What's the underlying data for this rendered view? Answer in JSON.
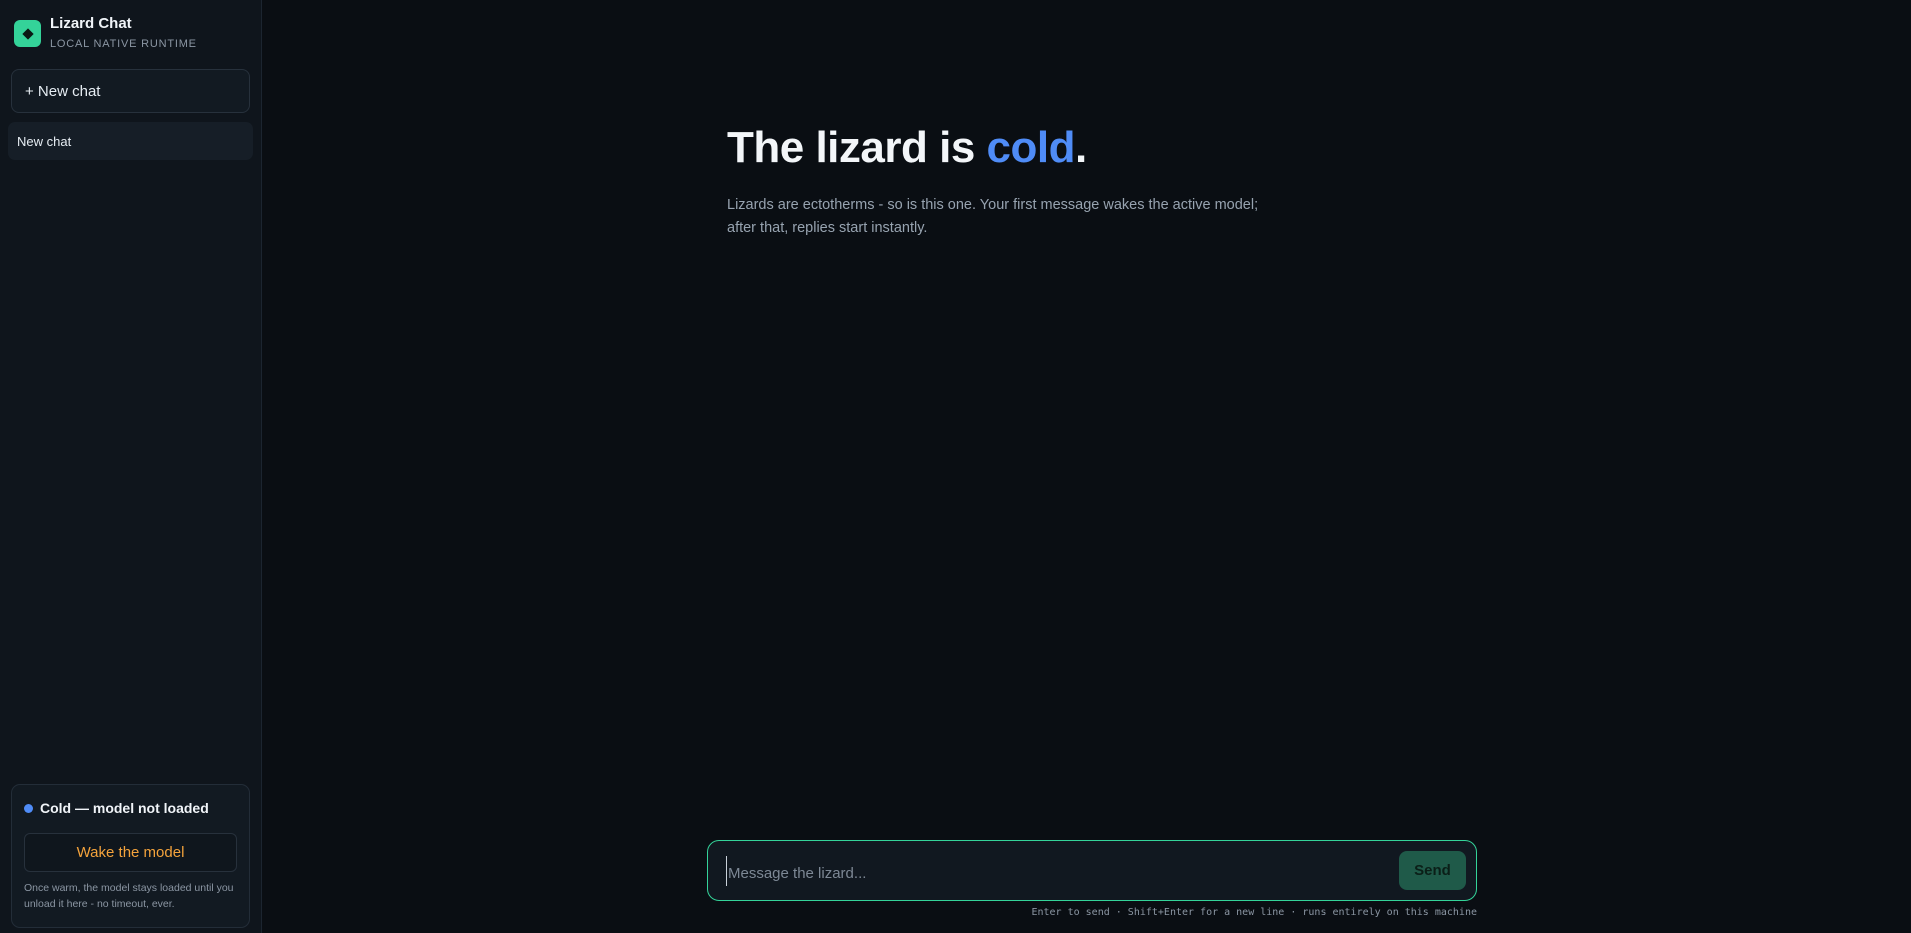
{
  "sidebar": {
    "brand": {
      "title": "Lizard Chat",
      "subtitle": "LOCAL NATIVE RUNTIME",
      "logo_icon": "diamond-icon",
      "logo_color": "#34d399"
    },
    "new_chat_label": "+ New chat",
    "chats": [
      {
        "label": "New chat"
      }
    ],
    "status": {
      "label": "Cold — model not loaded",
      "dot_color": "#4f8cf7",
      "wake_label": "Wake the model",
      "wake_color": "#f4a33c",
      "note": "Once warm, the model stays loaded until you unload it here - no timeout, ever."
    }
  },
  "main": {
    "hero": {
      "title_prefix": "The lizard is ",
      "title_accent": "cold",
      "title_suffix": ".",
      "accent_color": "#4f8cf7",
      "description": "Lizards are ectotherms - so is this one. Your first message wakes the active model; after that, replies start instantly."
    },
    "composer": {
      "placeholder": "Message the lizard...",
      "value": "",
      "send_label": "Send",
      "border_color": "#34d399"
    },
    "hint": "Enter to send · Shift+Enter for a new line · runs entirely on this machine"
  }
}
